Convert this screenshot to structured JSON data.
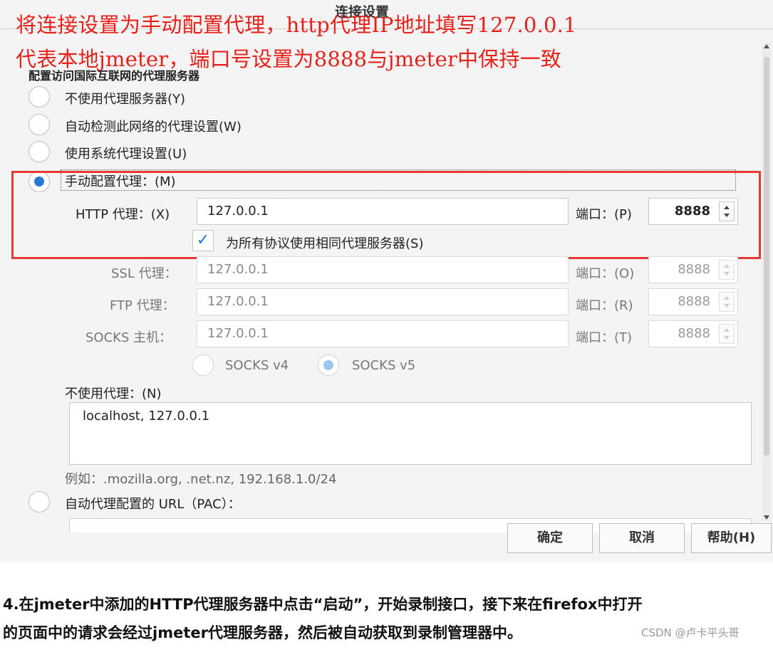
{
  "dialog": {
    "title": "连接设置",
    "section_heading": "配置访问国际互联网的代理服务器"
  },
  "annotation": {
    "line1": "将连接设置为手动配置代理，http代理IP地址填写127.0.0.1",
    "line2": "代表本地jmeter，端口号设置为8888与jmeter中保持一致",
    "color": "#e8201a"
  },
  "proxy_options": {
    "no_proxy": "不使用代理服务器(Y)",
    "auto_detect": "自动检测此网络的代理设置(W)",
    "system": "使用系统代理设置(U)",
    "manual": "手动配置代理：(M)",
    "selected": "manual"
  },
  "http": {
    "label": "HTTP 代理：(X)",
    "value": "127.0.0.1",
    "port_label": "端口：(P)",
    "port": "8888"
  },
  "same_proxy": {
    "label": "为所有协议使用相同代理服务器(S)",
    "checked": true
  },
  "ssl": {
    "label": "SSL 代理：",
    "value": "127.0.0.1",
    "port_label": "端口：(O)",
    "port": "8888"
  },
  "ftp": {
    "label": "FTP 代理：",
    "value": "127.0.0.1",
    "port_label": "端口：(R)",
    "port": "8888"
  },
  "socks": {
    "label": "SOCKS 主机：",
    "value": "127.0.0.1",
    "port_label": "端口：(T)",
    "port": "8888"
  },
  "socks_version": {
    "v4": "SOCKS v4",
    "v5": "SOCKS v5",
    "selected": "v5"
  },
  "no_proxy_for": {
    "label": "不使用代理：(N)",
    "value": "localhost, 127.0.0.1",
    "example": "例如：.mozilla.org, .net.nz, 192.168.1.0/24"
  },
  "pac": {
    "label": "自动代理配置的 URL（PAC）："
  },
  "buttons": {
    "ok": "确定",
    "cancel": "取消",
    "help": "帮助(H)"
  },
  "caption": {
    "line1": "4.在jmeter中添加的HTTP代理服务器中点击“启动”，开始录制接口，接下来在firefox中打开",
    "line2": "的页面中的请求会经过jmeter代理服务器，然后被自动获取到录制管理器中。"
  },
  "watermark": "CSDN @卢卡平头哥",
  "colors": {
    "accent": "#2b78d6",
    "highlight_box": "#e53935"
  }
}
